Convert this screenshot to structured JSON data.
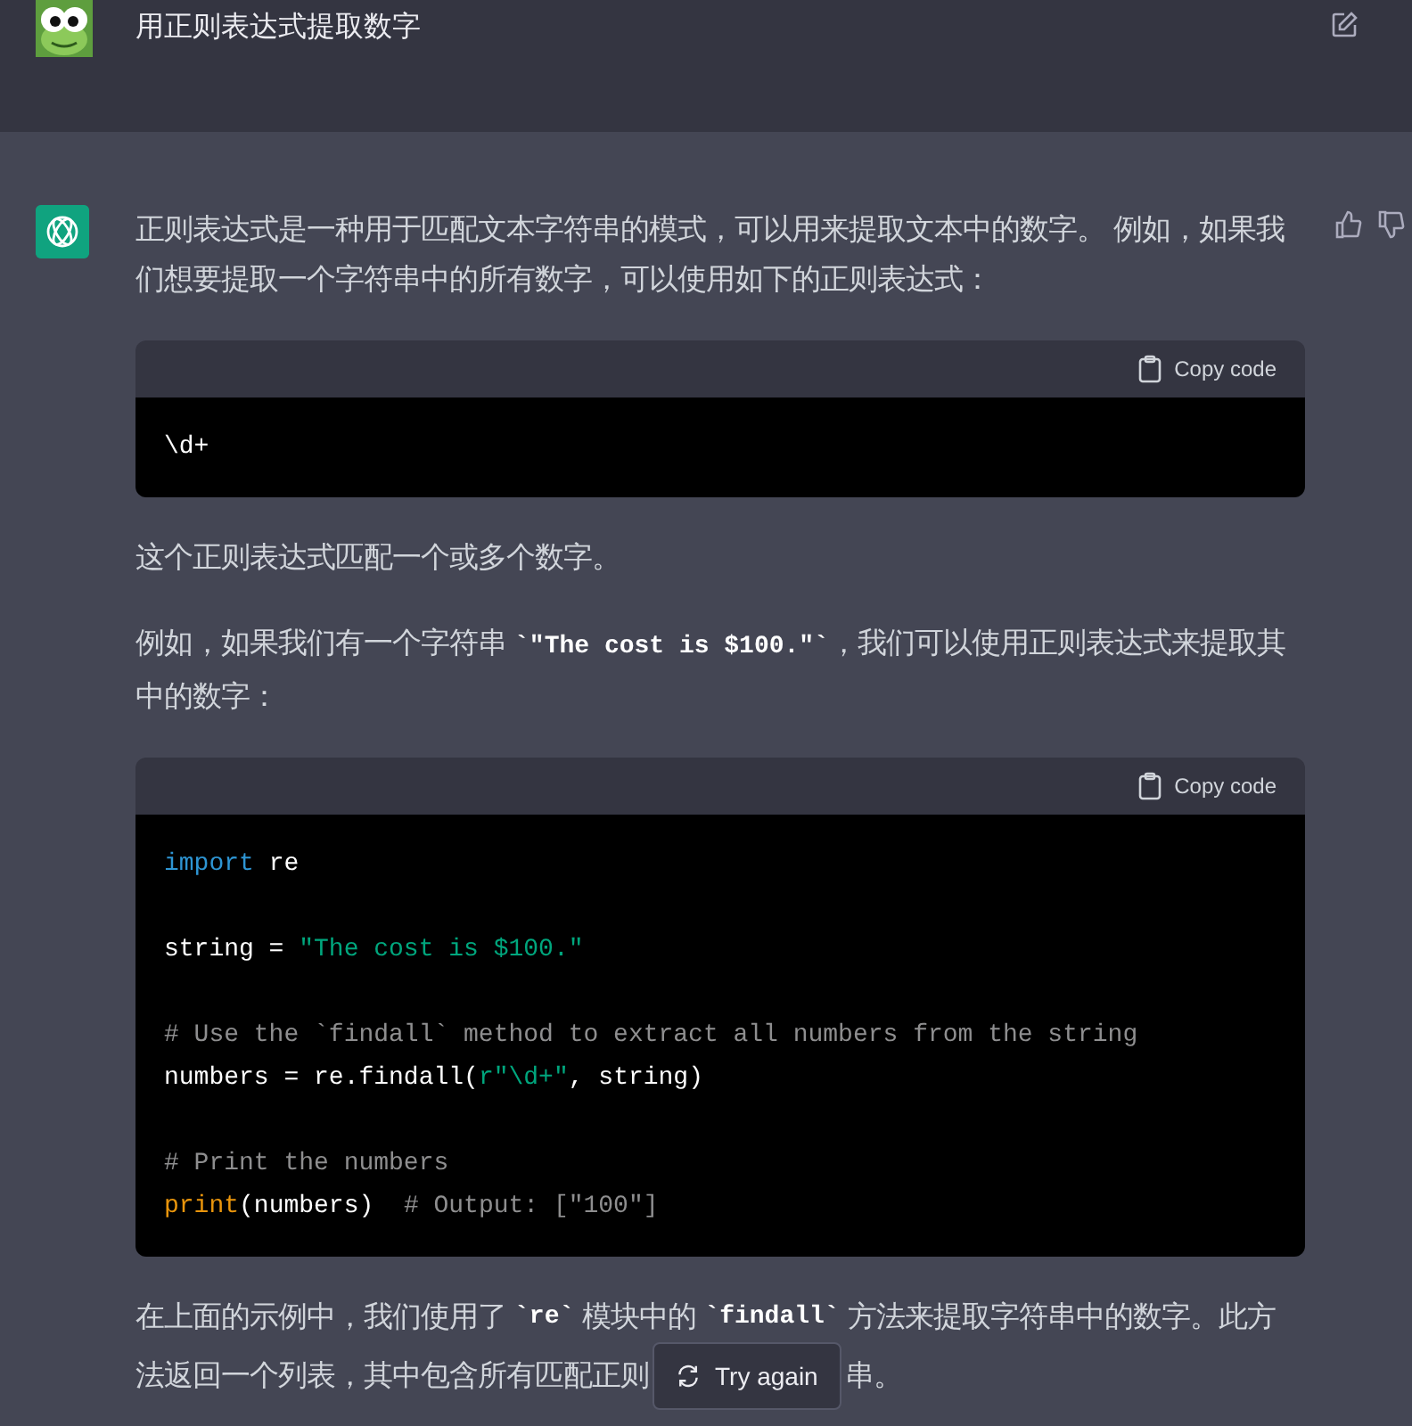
{
  "prompt": {
    "title": "用正则表达式提取数字"
  },
  "response": {
    "blocks": [
      {
        "kind": "paragraph",
        "parts": [
          {
            "kind": "text",
            "text": "正则表达式是一种用于匹配文本字符串的模式，可以用来提取文本中的数字。 例如，如果我们想要提取一个字符串中的所有数字，可以使用如下的正则表达式："
          }
        ]
      },
      {
        "kind": "code",
        "copy_label": "Copy code",
        "groups": [
          {
            "lines": [
              [
                {
                  "kind": "plain",
                  "text": "\\d+"
                }
              ]
            ]
          }
        ]
      },
      {
        "kind": "paragraph",
        "parts": [
          {
            "kind": "text",
            "text": "这个正则表达式匹配一个或多个数字。"
          }
        ]
      },
      {
        "kind": "paragraph",
        "parts": [
          {
            "kind": "text",
            "text": "例如，如果我们有一个字符串 "
          },
          {
            "kind": "code",
            "text": "`\"The cost is $100.\"`"
          },
          {
            "kind": "text",
            "text": "，我们可以使用正则表达式来提取其中的数字："
          }
        ]
      },
      {
        "kind": "code",
        "copy_label": "Copy code",
        "groups": [
          {
            "lines": [
              [
                {
                  "kind": "keyword",
                  "text": "import"
                },
                {
                  "kind": "plain",
                  "text": " re"
                }
              ]
            ]
          },
          {
            "lines": [
              [
                {
                  "kind": "plain",
                  "text": "string = "
                },
                {
                  "kind": "string",
                  "text": "\"The cost is $100.\""
                }
              ]
            ]
          },
          {
            "lines": [
              [
                {
                  "kind": "comment",
                  "text": "# Use the `findall` method to extract all numbers from the string"
                }
              ],
              [
                {
                  "kind": "plain",
                  "text": "numbers = re.findall("
                },
                {
                  "kind": "string",
                  "text": "r\"\\d+\""
                },
                {
                  "kind": "plain",
                  "text": ", string)"
                }
              ]
            ]
          },
          {
            "lines": [
              [
                {
                  "kind": "comment",
                  "text": "# Print the numbers"
                }
              ],
              [
                {
                  "kind": "builtin",
                  "text": "print"
                },
                {
                  "kind": "plain",
                  "text": "(numbers)  "
                },
                {
                  "kind": "comment",
                  "text": "# Output: [\"100\"]"
                }
              ]
            ]
          }
        ]
      },
      {
        "kind": "covered_paragraph",
        "lines": [
          [
            {
              "kind": "text",
              "text": "在上面的示例中，我们使用了 "
            },
            {
              "kind": "code",
              "text": "`re`"
            },
            {
              "kind": "text",
              "text": " 模块中的 "
            },
            {
              "kind": "code",
              "text": "`findall`"
            },
            {
              "kind": "text",
              "text": " 方法来提取字符串中的数字。此方"
            }
          ],
          [
            {
              "kind": "text",
              "text": "法返回一个列表，其中包含所有匹配正则"
            },
            {
              "kind": "cover"
            },
            {
              "kind": "text",
              "text": "串。"
            }
          ]
        ]
      }
    ]
  },
  "try_again": {
    "label": "Try again"
  }
}
